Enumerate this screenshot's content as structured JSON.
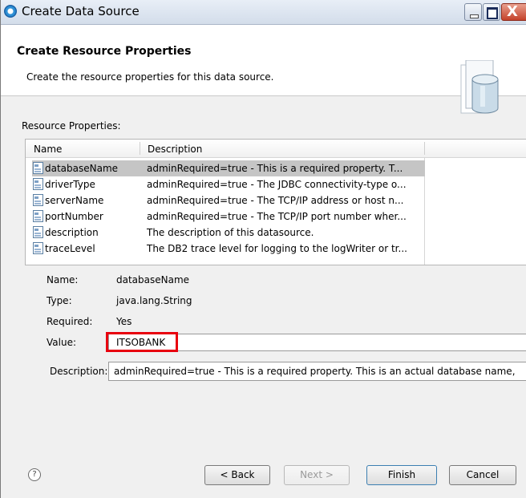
{
  "window": {
    "title": "Create Data Source",
    "controls": {
      "minimize_icon": "minimize-icon",
      "maximize_icon": "maximize-icon",
      "close_label": "X"
    }
  },
  "header": {
    "title": "Create Resource Properties",
    "description": "Create the resource properties for this data source."
  },
  "resource_properties": {
    "label": "Resource Properties:",
    "columns": [
      "Name",
      "Description"
    ],
    "rows": [
      {
        "name": "databaseName",
        "description": "adminRequired=true - This is a required property. T...",
        "selected": true
      },
      {
        "name": "driverType",
        "description": "adminRequired=true - The JDBC connectivity-type o..."
      },
      {
        "name": "serverName",
        "description": "adminRequired=true - The TCP/IP address or host n..."
      },
      {
        "name": "portNumber",
        "description": "adminRequired=true - The TCP/IP port number wher..."
      },
      {
        "name": "description",
        "description": "The description of this datasource."
      },
      {
        "name": "traceLevel",
        "description": "The DB2 trace level for logging to the logWriter or tr..."
      }
    ]
  },
  "details": {
    "name_label": "Name:",
    "name_value": "databaseName",
    "type_label": "Type:",
    "type_value": "java.lang.String",
    "required_label": "Required:",
    "required_value": "Yes",
    "value_label": "Value:",
    "value_value": "ITSOBANK",
    "description_label": "Description:",
    "description_value": "adminRequired=true - This is a required property. This is an actual database name,"
  },
  "footer": {
    "help_label": "?",
    "back_label": "< Back",
    "next_label": "Next >",
    "finish_label": "Finish",
    "cancel_label": "Cancel"
  },
  "colors": {
    "highlight": "#e8000f",
    "selection": "#c5c5c5"
  }
}
